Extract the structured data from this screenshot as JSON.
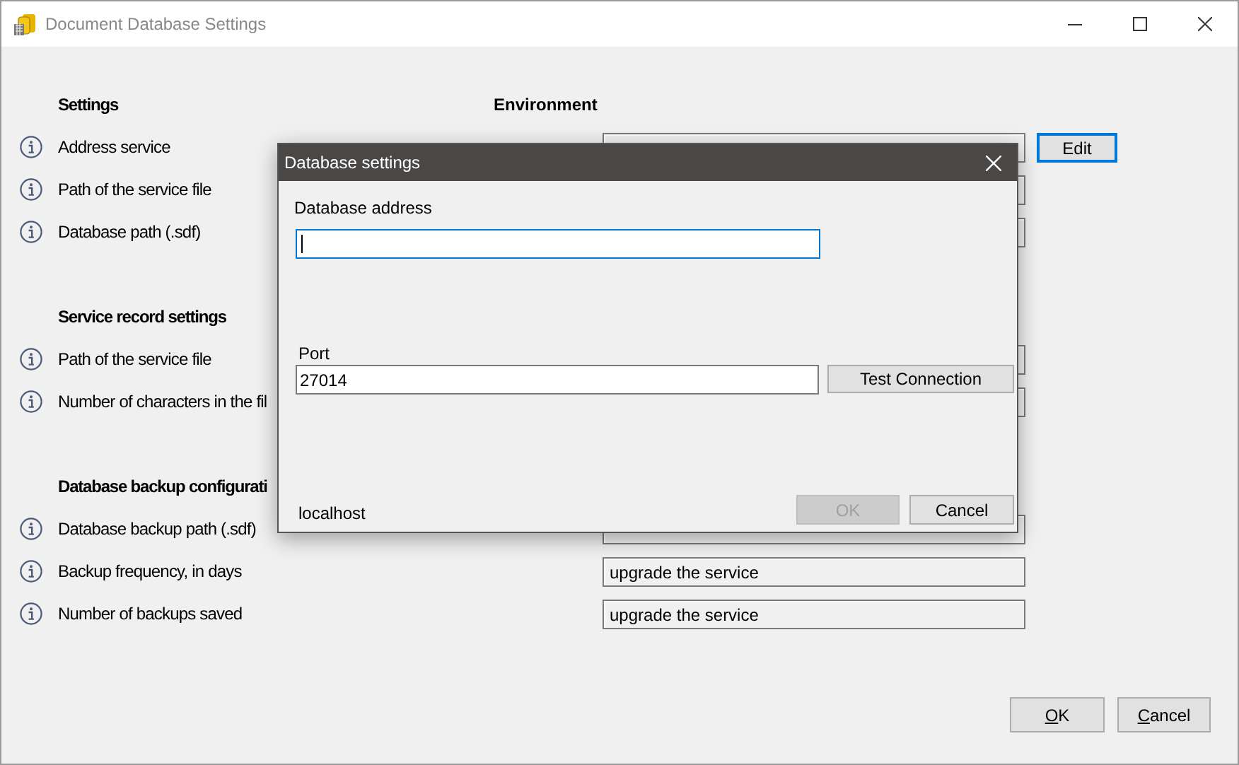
{
  "window": {
    "title": "Document Database Settings"
  },
  "sections": [
    {
      "title": "Settings",
      "column_title": "Environment",
      "rows": [
        {
          "label": "Address service",
          "kind": "field_button",
          "button": {
            "label": "Edit",
            "default": true
          }
        },
        {
          "label": "Path of the service file",
          "kind": "field"
        },
        {
          "label": "Database path (.sdf)",
          "kind": "field"
        }
      ]
    },
    {
      "title": "Service record settings",
      "rows": [
        {
          "label": "Path of the service file",
          "kind": "field"
        },
        {
          "label": "Number of characters in the fil",
          "kind": "field"
        }
      ]
    },
    {
      "title": "Database backup configurati",
      "rows": [
        {
          "label": "Database backup path (.sdf)",
          "kind": "field"
        },
        {
          "label": "Backup frequency, in days",
          "kind": "field",
          "value": "upgrade the service"
        },
        {
          "label": "Number of backups saved",
          "kind": "field",
          "value": "upgrade the service"
        }
      ]
    }
  ],
  "buttons": [
    {
      "label": "OK",
      "mnemonic": true
    },
    {
      "label": "Cancel",
      "mnemonic": true
    }
  ],
  "dialog": {
    "title": "Database settings",
    "address_label": "Database address",
    "address_focused": true,
    "port_label": "Port",
    "port_value": "27014",
    "test_button": "Test Connection",
    "host": "localhost",
    "buttons": [
      {
        "label": "OK",
        "disabled": true
      },
      {
        "label": "Cancel",
        "disabled": false
      }
    ]
  }
}
